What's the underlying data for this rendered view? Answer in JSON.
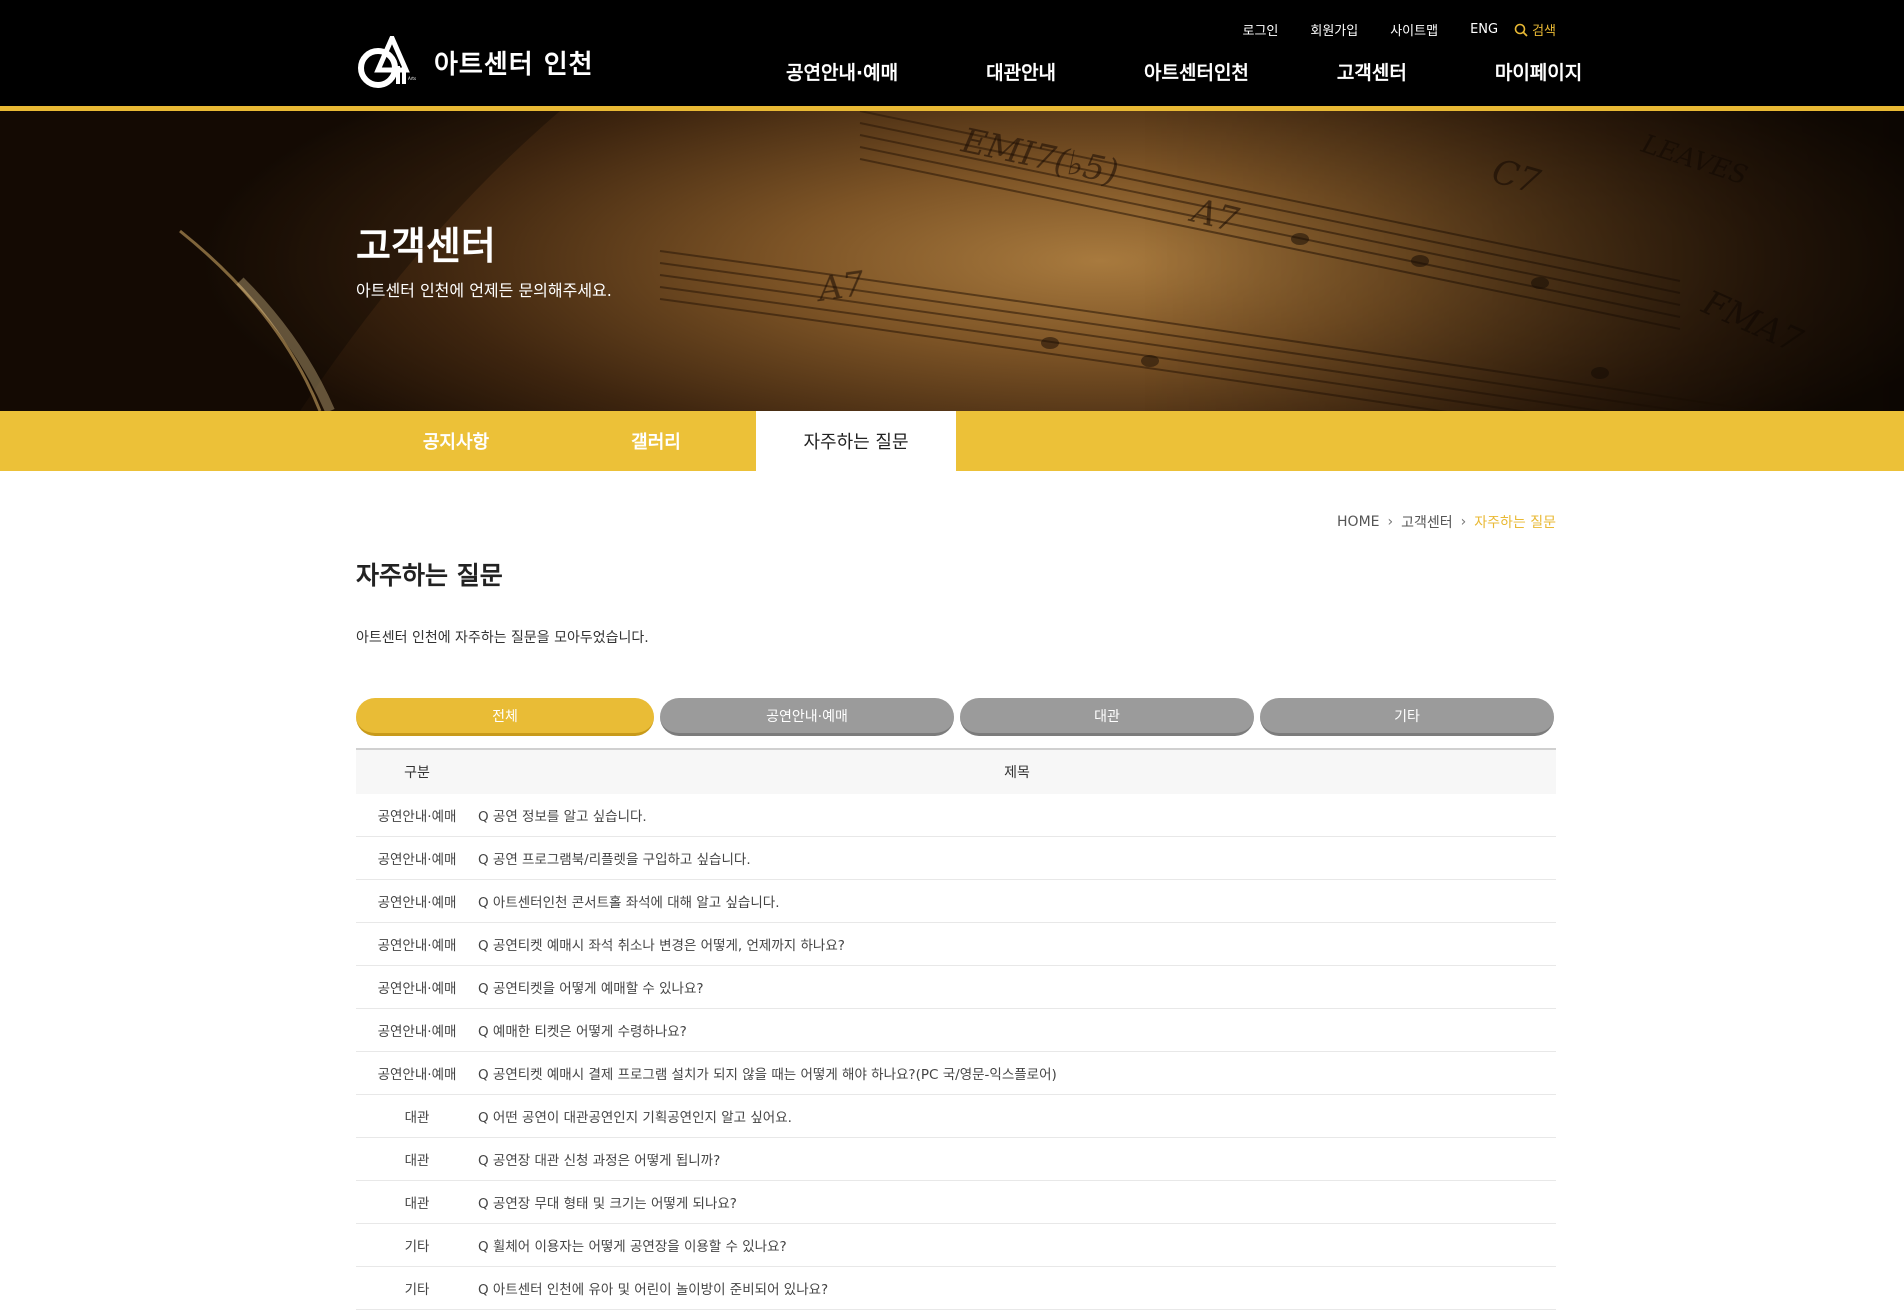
{
  "header": {
    "logo_text": "아트센터 인천",
    "util": {
      "login": "로그인",
      "signup": "회원가입",
      "sitemap": "사이트맵",
      "eng": "ENG",
      "search": "검색"
    },
    "gnb": [
      "공연안내·예매",
      "대관안내",
      "아트센터인천",
      "고객센터",
      "마이페이지"
    ]
  },
  "banner": {
    "title": "고객센터",
    "subtitle": "아트센터 인천에 언제든 문의해주세요."
  },
  "lnb": {
    "tabs": [
      "공지사항",
      "갤러리",
      "자주하는 질문"
    ]
  },
  "breadcrumb": {
    "home": "HOME",
    "level1": "고객센터",
    "current": "자주하는 질문"
  },
  "page": {
    "title": "자주하는 질문",
    "description": "아트센터 인천에 자주하는 질문을 모아두었습니다."
  },
  "filters": [
    "전체",
    "공연안내·예매",
    "대관",
    "기타"
  ],
  "table": {
    "headers": {
      "category": "구분",
      "title": "제목"
    },
    "rows": [
      {
        "category": "공연안내·예매",
        "title": "Q  공연 정보를 알고 싶습니다."
      },
      {
        "category": "공연안내·예매",
        "title": "Q  공연 프로그램북/리플렛을 구입하고 싶습니다."
      },
      {
        "category": "공연안내·예매",
        "title": "Q  아트센터인천 콘서트홀 좌석에 대해 알고 싶습니다."
      },
      {
        "category": "공연안내·예매",
        "title": "Q  공연티켓 예매시 좌석 취소나 변경은 어떻게, 언제까지 하나요?"
      },
      {
        "category": "공연안내·예매",
        "title": "Q  공연티켓을 어떻게 예매할 수 있나요?"
      },
      {
        "category": "공연안내·예매",
        "title": "Q  예매한 티켓은 어떻게 수령하나요?"
      },
      {
        "category": "공연안내·예매",
        "title": "Q  공연티켓 예매시 결제 프로그램 설치가 되지 않을 때는 어떻게 해야 하나요?(PC 국/영문-익스플로어)"
      },
      {
        "category": "대관",
        "title": "Q  어떤 공연이 대관공연인지 기획공연인지 알고 싶어요."
      },
      {
        "category": "대관",
        "title": "Q  공연장 대관 신청 과정은 어떻게 됩니까?"
      },
      {
        "category": "대관",
        "title": "Q  공연장 무대 형태 및 크기는 어떻게 되나요?"
      },
      {
        "category": "기타",
        "title": "Q  휠체어 이용자는 어떻게 공연장을 이용할 수 있나요?"
      },
      {
        "category": "기타",
        "title": "Q  아트센터 인천에 유아 및 어린이 놀이방이 준비되어 있나요?"
      }
    ]
  },
  "colors": {
    "accent": "#e9b934",
    "header_bg": "#000000",
    "filter_inactive": "#9b9b9b"
  }
}
